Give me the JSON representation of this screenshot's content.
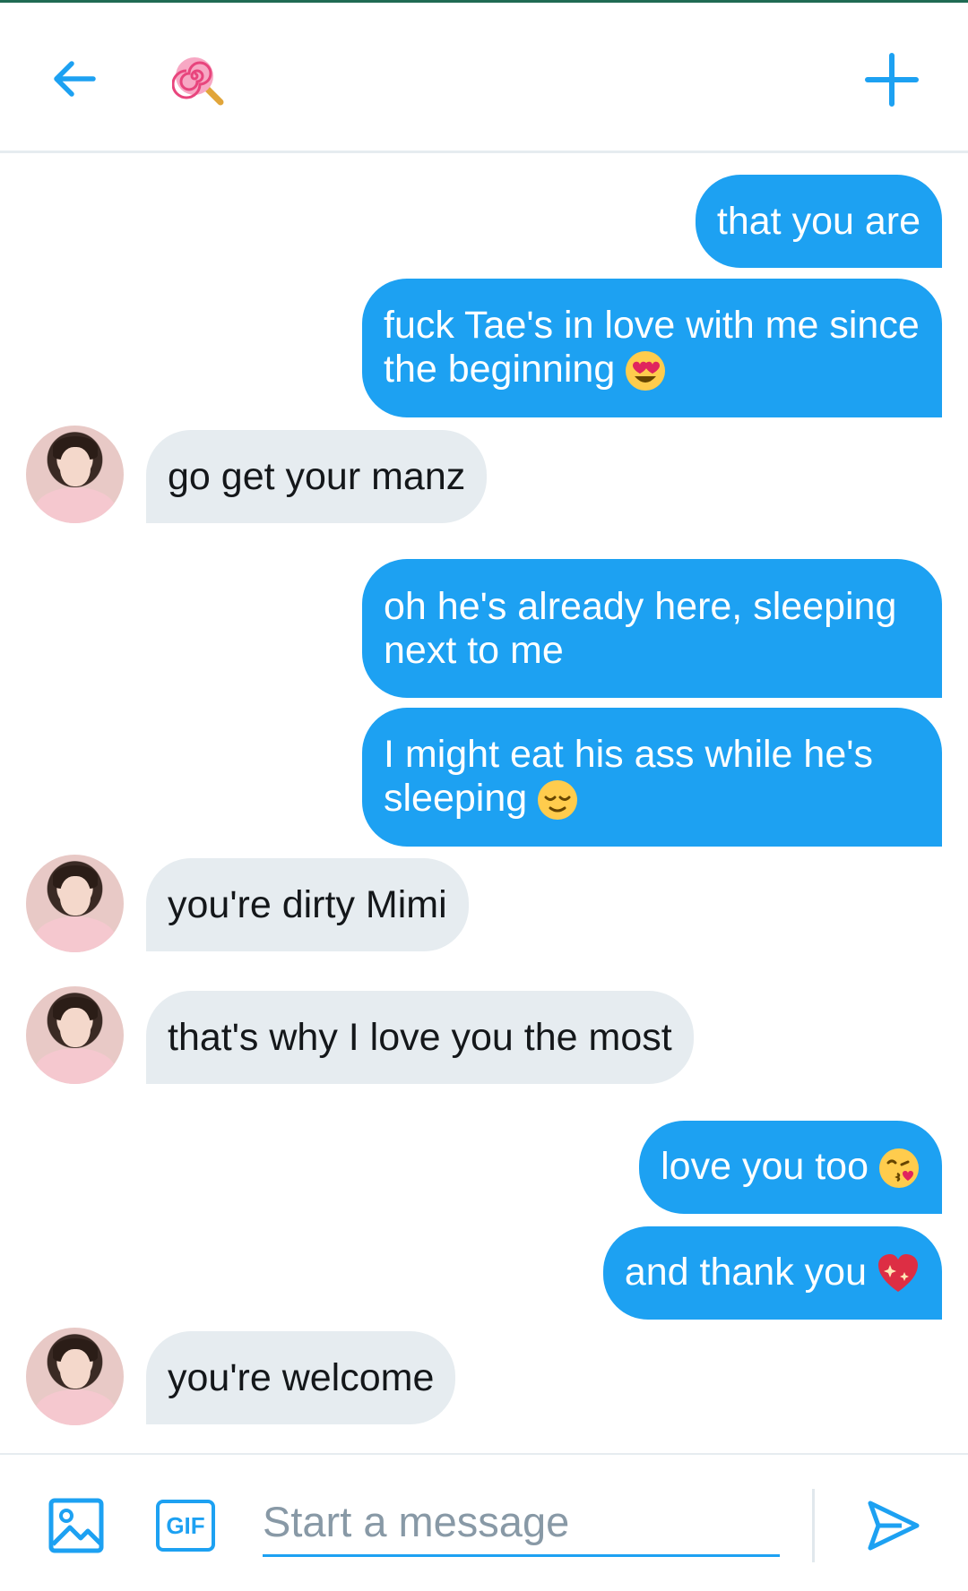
{
  "header": {
    "back_icon": "arrow-left-icon",
    "conversation_icon": "lollipop-emoji",
    "new_icon": "plus-icon",
    "accent": "#1da1f2"
  },
  "messages": [
    {
      "side": "sent",
      "text": "that you are"
    },
    {
      "side": "sent",
      "text": "fuck Tae's in love with me since the beginning",
      "emoji": "heart-eyes-emoji"
    },
    {
      "side": "received",
      "text": "go get your manz"
    },
    {
      "side": "sent",
      "text": "oh he's already here, sleeping next to me"
    },
    {
      "side": "sent",
      "text": "I might eat his ass while he's sleeping",
      "emoji": "relieved-emoji"
    },
    {
      "side": "received",
      "text": "you're dirty Mimi"
    },
    {
      "side": "received",
      "text": "that's why I love you the most"
    },
    {
      "side": "sent",
      "text": "love you too",
      "emoji": "kissing-heart-emoji"
    },
    {
      "side": "sent",
      "text": "and thank you",
      "emoji": "sparkling-heart-emoji"
    },
    {
      "side": "received",
      "text": "you're welcome"
    }
  ],
  "composer": {
    "placeholder": "Start a message",
    "gif_label": "GIF",
    "media_icon": "image-icon",
    "send_icon": "send-icon"
  },
  "colors": {
    "sent_bubble": "#1da1f2",
    "received_bubble": "#e6ecf0",
    "text_dark": "#14171a",
    "placeholder": "#8899a6"
  }
}
